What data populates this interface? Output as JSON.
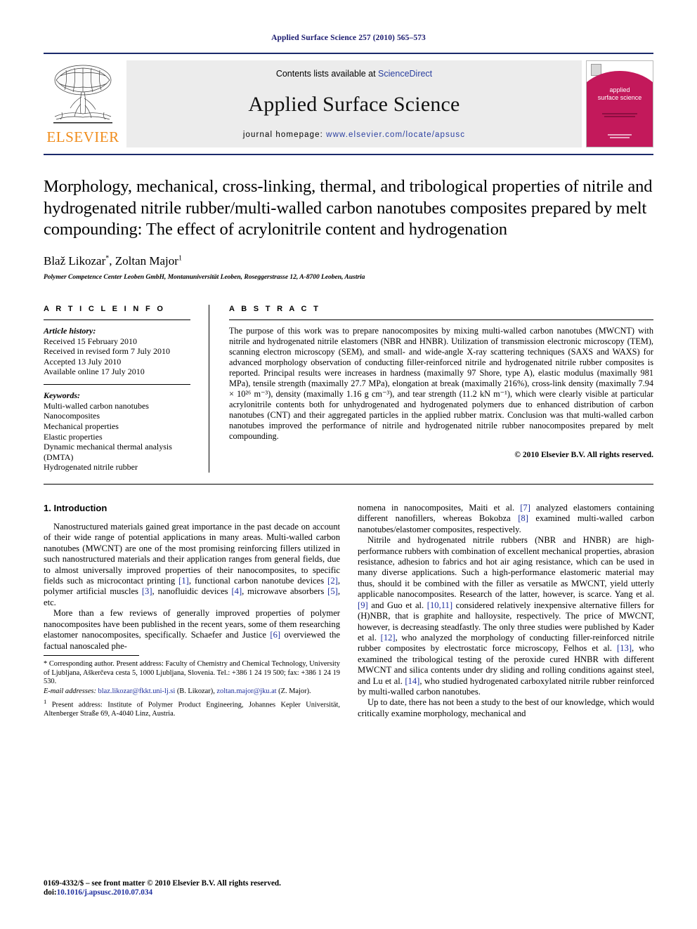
{
  "running_head": "Applied Surface Science 257 (2010) 565–573",
  "masthead": {
    "publisher": "ELSEVIER",
    "contents_prefix": "Contents lists available at ",
    "contents_link": "ScienceDirect",
    "journal_name": "Applied Surface Science",
    "homepage_prefix": "journal homepage:  ",
    "homepage_url": "www.elsevier.com/locate/apsusc",
    "cover_title_line1": "applied",
    "cover_title_line2": "surface science"
  },
  "article": {
    "title": "Morphology, mechanical, cross-linking, thermal, and tribological properties of nitrile and hydrogenated nitrile rubber/multi-walled carbon nanotubes composites prepared by melt compounding: The effect of acrylonitrile content and hydrogenation",
    "authors": "Blaž Likozar",
    "author_marker": "*",
    "author2": ", Zoltan Major",
    "author2_marker": "1",
    "affiliation": "Polymer Competence Center Leoben GmbH, Montanuniversität Leoben, Roseggerstrasse 12, A-8700 Leoben, Austria"
  },
  "info": {
    "heading": "A R T I C L E    I N F O",
    "history_title": "Article history:",
    "history": [
      "Received 15 February 2010",
      "Received in revised form 7 July 2010",
      "Accepted 13 July 2010",
      "Available online 17 July 2010"
    ],
    "keywords_title": "Keywords:",
    "keywords": [
      "Multi-walled carbon nanotubes",
      "Nanocomposites",
      "Mechanical properties",
      "Elastic properties",
      "Dynamic mechanical thermal analysis",
      "(DMTA)",
      "Hydrogenated nitrile rubber"
    ]
  },
  "abstract": {
    "heading": "A B S T R A C T",
    "text": "The purpose of this work was to prepare nanocomposites by mixing multi-walled carbon nanotubes (MWCNT) with nitrile and hydrogenated nitrile elastomers (NBR and HNBR). Utilization of transmission electronic microscopy (TEM), scanning electron microscopy (SEM), and small- and wide-angle X-ray scattering techniques (SAXS and WAXS) for advanced morphology observation of conducting filler-reinforced nitrile and hydrogenated nitrile rubber composites is reported. Principal results were increases in hardness (maximally 97 Shore, type A), elastic modulus (maximally 981 MPa), tensile strength (maximally 27.7 MPa), elongation at break (maximally 216%), cross-link density (maximally 7.94 × 10²⁶ m⁻³), density (maximally 1.16 g cm⁻³), and tear strength (11.2 kN m⁻¹), which were clearly visible at particular acrylonitrile contents both for unhydrogenated and hydrogenated polymers due to enhanced distribution of carbon nanotubes (CNT) and their aggregated particles in the applied rubber matrix. Conclusion was that multi-walled carbon nanotubes improved the performance of nitrile and hydrogenated nitrile rubber nanocomposites prepared by melt compounding.",
    "copyright": "© 2010 Elsevier B.V. All rights reserved."
  },
  "body": {
    "section_title": "1.  Introduction",
    "left_p1_a": "Nanostructured materials gained great importance in the past decade on account of their wide range of potential applications in many areas. Multi-walled carbon nanotubes (MWCNT) are one of the most promising reinforcing fillers utilized in such nanostructured materials and their application ranges from general fields, due to almost universally improved properties of their nanocomposites, to specific fields such as microcontact printing ",
    "ref1": "[1]",
    "left_p1_b": ", functional carbon nanotube devices ",
    "ref2": "[2]",
    "left_p1_c": ", polymer artificial muscles ",
    "ref3": "[3]",
    "left_p1_d": ", nanofluidic devices ",
    "ref4": "[4]",
    "left_p1_e": ", microwave absorbers ",
    "ref5": "[5]",
    "left_p1_f": ", etc.",
    "left_p2_a": "More than a few reviews of generally improved properties of polymer nanocomposites have been published in the recent years, some of them researching elastomer nanocomposites, specifically. Schaefer and Justice ",
    "ref6": "[6]",
    "left_p2_b": " overviewed the factual nanoscaled phe-",
    "right_p1_a": "nomena in nanocomposites, Maiti et al. ",
    "ref7": "[7]",
    "right_p1_b": " analyzed elastomers containing different nanofillers, whereas Bokobza ",
    "ref8": "[8]",
    "right_p1_c": " examined multi-walled carbon nanotubes/elastomer composites, respectively.",
    "right_p2_a": "Nitrile and hydrogenated nitrile rubbers (NBR and HNBR) are high-performance rubbers with combination of excellent mechanical properties, abrasion resistance, adhesion to fabrics and hot air aging resistance, which can be used in many diverse applications. Such a high-performance elastomeric material may thus, should it be combined with the filler as versatile as MWCNT, yield utterly applicable nanocomposites. Research of the latter, however, is scarce. Yang et al. ",
    "ref9": "[9]",
    "right_p2_b": " and Guo et al. ",
    "ref1011": "[10,11]",
    "right_p2_c": " considered relatively inexpensive alternative fillers for (H)NBR, that is graphite and halloysite, respectively. The price of MWCNT, however, is decreasing steadfastly. The only three studies were published by Kader et al. ",
    "ref12": "[12]",
    "right_p2_d": ", who analyzed the morphology of conducting filler-reinforced nitrile rubber composites by electrostatic force microscopy, Felhos et al. ",
    "ref13": "[13]",
    "right_p2_e": ", who examined the tribological testing of the peroxide cured HNBR with different MWCNT and silica contents under dry sliding and rolling conditions against steel, and Lu et al. ",
    "ref14": "[14]",
    "right_p2_f": ", who studied hydrogenated carboxylated nitrile rubber reinforced by multi-walled carbon nanotubes.",
    "right_p3": "Up to date, there has not been a study to the best of our knowledge, which would critically examine morphology, mechanical and"
  },
  "footnotes": {
    "corresponding": "* Corresponding author. Present address: Faculty of Chemistry and Chemical Technology, University of Ljubljana, Aškerčeva cesta 5, 1000 Ljubljana, Slovenia. Tel.: +386 1 24 19 500; fax: +386 1 24 19 530.",
    "email_label": "E-mail addresses:",
    "email1": "blaz.likozar@fkkt.uni-lj.si",
    "email1_owner": " (B. Likozar), ",
    "email2": "zoltan.major@jku.at",
    "email2_owner": " (Z. Major).",
    "present_marker": "1",
    "present_address": " Present address: Institute of Polymer Product Engineering, Johannes Kepler Universität, Altenberger Straße 69, A-4040 Linz, Austria."
  },
  "bottom": {
    "issn_line": "0169-4332/$ – see front matter © 2010 Elsevier B.V. All rights reserved.",
    "doi_prefix": "doi:",
    "doi": "10.1016/j.apsusc.2010.07.034"
  },
  "colors": {
    "link_blue": "#2a3fa0",
    "ref_blue": "#1f2f9e",
    "rule_navy": "#1b2a6b",
    "elsevier_orange": "#F08C1B",
    "cover_magenta": "#C3195B"
  }
}
